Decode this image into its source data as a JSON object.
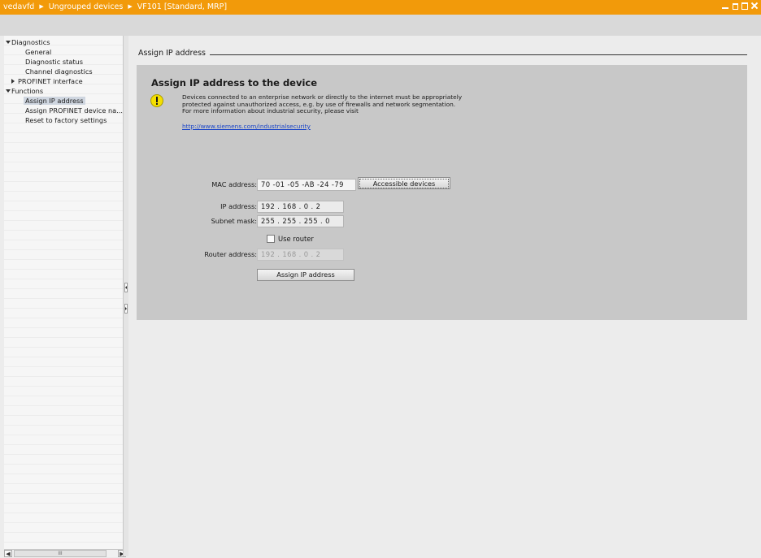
{
  "titlebar": {
    "breadcrumbs": [
      "vedavfd",
      "Ungrouped devices",
      "VF101 [Standard, MRP]"
    ],
    "separator": "▶"
  },
  "nav": {
    "items": [
      {
        "label": "Diagnostics",
        "level": 0,
        "expanded": true
      },
      {
        "label": "General",
        "level": 1
      },
      {
        "label": "Diagnostic status",
        "level": 1
      },
      {
        "label": "Channel diagnostics",
        "level": 1
      },
      {
        "label": "PROFINET interface",
        "level": 1,
        "collapsed": true
      },
      {
        "label": "Functions",
        "level": 0,
        "expanded": true
      },
      {
        "label": "Assign IP address",
        "level": 1,
        "selected": true
      },
      {
        "label": "Assign PROFINET device na...",
        "level": 1
      },
      {
        "label": "Reset to factory settings",
        "level": 1
      }
    ],
    "scrollbar_thumb_label": "III"
  },
  "main": {
    "section_title": "Assign IP address",
    "heading": "Assign IP address to the device",
    "warning_lines": [
      "Devices connected to an enterprise network or directly to the internet must be appropriately",
      "protected against unauthorized access, e.g. by use of firewalls and network segmentation.",
      "For more information about industrial security, please visit"
    ],
    "warning_link": "http://www.siemens.com/industrialsecurity",
    "form": {
      "mac_label": "MAC address:",
      "mac_value": "70 -01 -05 -AB -24 -79",
      "accessible_devices_button": "Accessible devices",
      "ip_label": "IP address:",
      "ip_value": "192 . 168 . 0    . 2",
      "subnet_label": "Subnet mask:",
      "subnet_value": "255 . 255 . 255 . 0",
      "use_router_label": "Use router",
      "use_router_checked": false,
      "router_label": "Router address:",
      "router_value": "192 . 168 . 0    . 2",
      "assign_button": "Assign IP address"
    }
  },
  "colors": {
    "titlebar": "#f29a0a",
    "panel": "#c8c8c8",
    "link": "#1a45c8",
    "warning_icon": "#f4df00"
  }
}
